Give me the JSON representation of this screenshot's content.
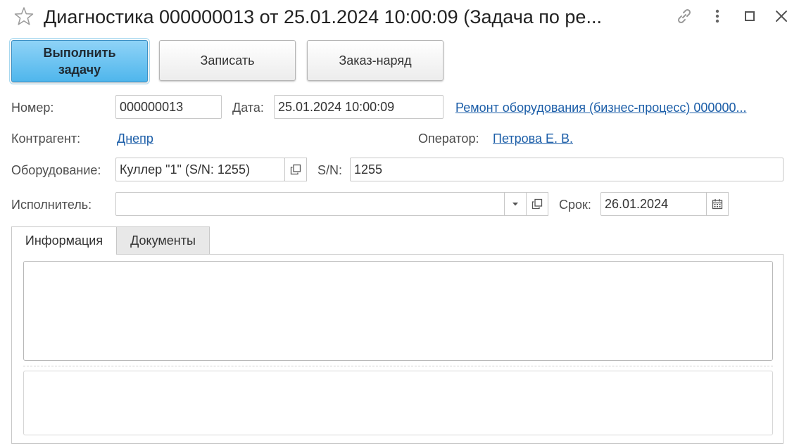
{
  "window": {
    "title": "Диагностика 000000013 от 25.01.2024 10:00:09 (Задача по ре..."
  },
  "toolbar": {
    "execute_label": "Выполнить задачу",
    "save_label": "Записать",
    "order_label": "Заказ-наряд"
  },
  "form": {
    "number_label": "Номер:",
    "number_value": "000000013",
    "date_label": "Дата:",
    "date_value": "25.01.2024 10:00:09",
    "process_link": "Ремонт оборудования (бизнес-процесс) 000000...",
    "counterparty_label": "Контрагент:",
    "counterparty_link": "Днепр",
    "operator_label": "Оператор:",
    "operator_link": "Петрова Е. В.",
    "equipment_label": "Оборудование:",
    "equipment_value": "Куллер \"1\" (S/N: 1255)",
    "sn_label": "S/N:",
    "sn_value": "1255",
    "executor_label": "Исполнитель:",
    "executor_value": "",
    "deadline_label": "Срок:",
    "deadline_value": "26.01.2024"
  },
  "tabs": [
    {
      "label": "Информация",
      "active": true
    },
    {
      "label": "Документы",
      "active": false
    }
  ],
  "colors": {
    "primary_button": "#4fb6ec",
    "link": "#1c5ea8"
  },
  "icons": {
    "favorite": "star-icon",
    "link": "link-icon",
    "more": "more-vertical-icon",
    "maximize": "maximize-icon",
    "close": "close-icon",
    "open": "open-icon",
    "dropdown": "chevron-down-icon",
    "calendar": "calendar-icon"
  }
}
